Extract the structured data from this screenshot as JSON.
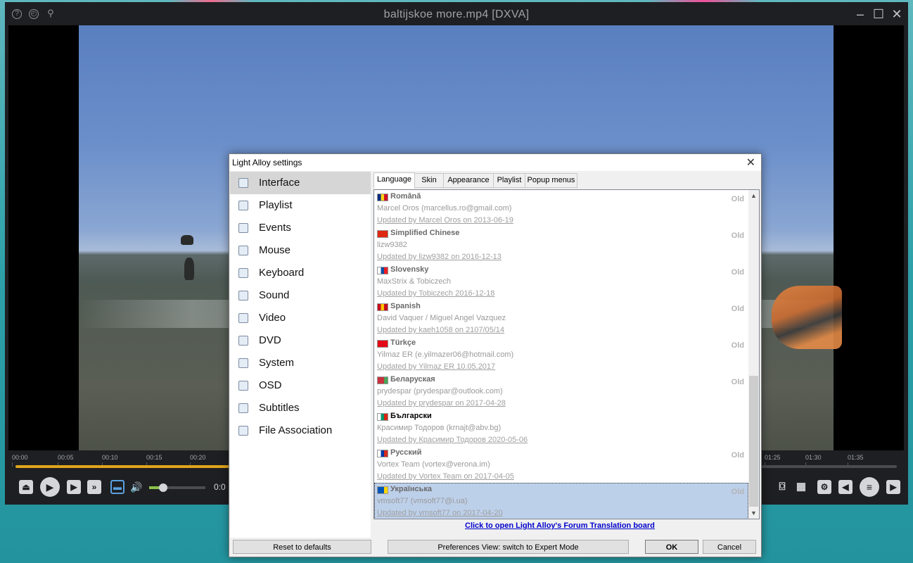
{
  "player": {
    "title": "baltijskoe more.mp4 [DXVA]",
    "timeline_ticks": [
      "00:00",
      "00:05",
      "00:10",
      "00:15",
      "00:20",
      "01:25",
      "01:30",
      "01:35"
    ],
    "progress_fraction": 0.25,
    "volume_fraction": 0.25,
    "time_display": "0:0",
    "colors": {
      "seek_fill": "#e0a51b",
      "volume_fill": "#8bc34a"
    }
  },
  "dialog": {
    "title": "Light Alloy settings",
    "nav": [
      {
        "label": "Interface",
        "icon": "interface-icon",
        "selected": true
      },
      {
        "label": "Playlist",
        "icon": "playlist-icon"
      },
      {
        "label": "Events",
        "icon": "events-icon"
      },
      {
        "label": "Mouse",
        "icon": "mouse-icon"
      },
      {
        "label": "Keyboard",
        "icon": "keyboard-icon"
      },
      {
        "label": "Sound",
        "icon": "sound-icon"
      },
      {
        "label": "Video",
        "icon": "video-icon"
      },
      {
        "label": "DVD",
        "icon": "dvd-icon"
      },
      {
        "label": "System",
        "icon": "system-icon"
      },
      {
        "label": "OSD",
        "icon": "osd-icon"
      },
      {
        "label": "Subtitles",
        "icon": "subtitles-icon"
      },
      {
        "label": "File Association",
        "icon": "file-association-icon"
      }
    ],
    "tabs": [
      "Language",
      "Skin",
      "Appearance",
      "Playlist",
      "Popup menus"
    ],
    "languages": [
      {
        "name": "Română",
        "author": "Marcel Oros (marcellus.ro@gmail.com)",
        "updated": "Updated by Marcel Oros on 2013-06-19",
        "status": "Old",
        "flag": [
          "#002b7f",
          "#fcd116",
          "#ce1126"
        ]
      },
      {
        "name": "Simplified Chinese",
        "author": "lizw9382",
        "updated": "Updated by lizw9382 on 2016-12-13",
        "status": "Old",
        "flag": [
          "#de2910",
          "#de2910",
          "#de2910"
        ]
      },
      {
        "name": "Slovensky",
        "author": "MaxStrix & Tobiczech",
        "updated": "Updated by Tobiczech 2016-12-18",
        "status": "Old",
        "flag": [
          "#ffffff",
          "#0b4ea2",
          "#ee1c25"
        ]
      },
      {
        "name": "Spanish",
        "author": "David Vaquer / Miguel Angel Vazquez",
        "updated": "Updated by kaeh1058 on 2107/05/14",
        "status": "Old",
        "flag": [
          "#c60b1e",
          "#ffc400",
          "#c60b1e"
        ]
      },
      {
        "name": "Türkçe",
        "author": "Yilmaz ER (e.yilmazer06@hotmail.com)",
        "updated": "Updated by Yilmaz ER  10.05.2017",
        "status": "Old",
        "flag": [
          "#e30a17",
          "#e30a17",
          "#e30a17"
        ]
      },
      {
        "name": "Беларуская",
        "author": "prydespar (prydespar@outlook.com)",
        "updated": "Updated by prydespar on 2017-04-28",
        "status": "Old",
        "flag": [
          "#c8313e",
          "#c8313e",
          "#4aa657"
        ]
      },
      {
        "name": "Български",
        "author": "Красимир Тодоров (krnajt@abv.bg)",
        "updated": "Updated by Красимир Тодоров 2020-05-06",
        "status": "",
        "flag": [
          "#ffffff",
          "#00966e",
          "#d62612"
        ]
      },
      {
        "name": "Русский",
        "author": "Vortex Team (vortex@verona.im)",
        "updated": "Updated by Vortex Team on 2017-04-05",
        "status": "Old",
        "flag": [
          "#ffffff",
          "#0039a6",
          "#d52b1e"
        ]
      },
      {
        "name": "Українська",
        "author": "vmsoft77 (vmsoft77@i.ua)",
        "updated": "Updated by vmsoft77 on 2017-04-20",
        "status": "Old",
        "flag": [
          "#0057b7",
          "#0057b7",
          "#ffd700"
        ],
        "selected": true
      }
    ],
    "forum_link": "Click to open Light Alloy's Forum Translation board",
    "buttons": {
      "reset": "Reset to defaults",
      "view": "Preferences View: switch to Expert Mode",
      "ok": "OK",
      "cancel": "Cancel"
    }
  }
}
